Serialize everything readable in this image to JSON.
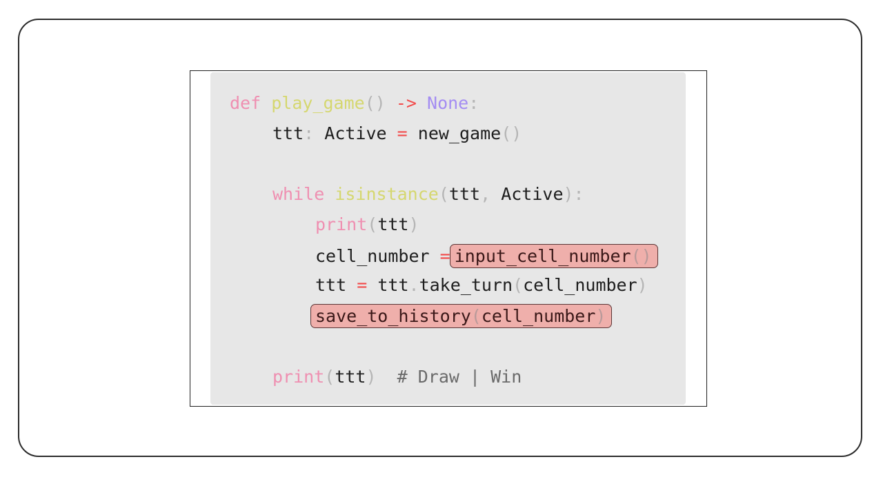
{
  "code": {
    "line1": {
      "def": "def",
      "fname": "play_game",
      "parens": "()",
      "arrow": "->",
      "rtype": "None",
      "colon": ":"
    },
    "line2": {
      "var": "ttt",
      "colon": ":",
      "type": "Active",
      "eq": "=",
      "call": "new_game",
      "parens": "()"
    },
    "line3": {
      "kw": "while",
      "fn": "isinstance",
      "lparen": "(",
      "arg1": "ttt",
      "comma": ",",
      "arg2": "Active",
      "rparen_colon": "):"
    },
    "line4": {
      "fn": "print",
      "lparen": "(",
      "arg": "ttt",
      "rparen": ")"
    },
    "line5": {
      "var": "cell_number",
      "eq": "=",
      "call": "input_cell_number",
      "parens": "()"
    },
    "line6": {
      "var": "ttt",
      "eq": "=",
      "obj": "ttt",
      "dot": ".",
      "method": "take_turn",
      "lparen": "(",
      "arg": "cell_number",
      "rparen": ")"
    },
    "line7": {
      "call": "save_to_history",
      "lparen": "(",
      "arg": "cell_number",
      "rparen": ")"
    },
    "line8": {
      "fn": "print",
      "lparen": "(",
      "arg": "ttt",
      "rparen": ")",
      "comment": "# Draw | Win"
    }
  },
  "colors": {
    "keyword": "#ef8fb1",
    "function": "#d5d76f",
    "arrow": "#f24a4a",
    "type_none": "#a48df2",
    "highlight_fill": "#efafab"
  }
}
